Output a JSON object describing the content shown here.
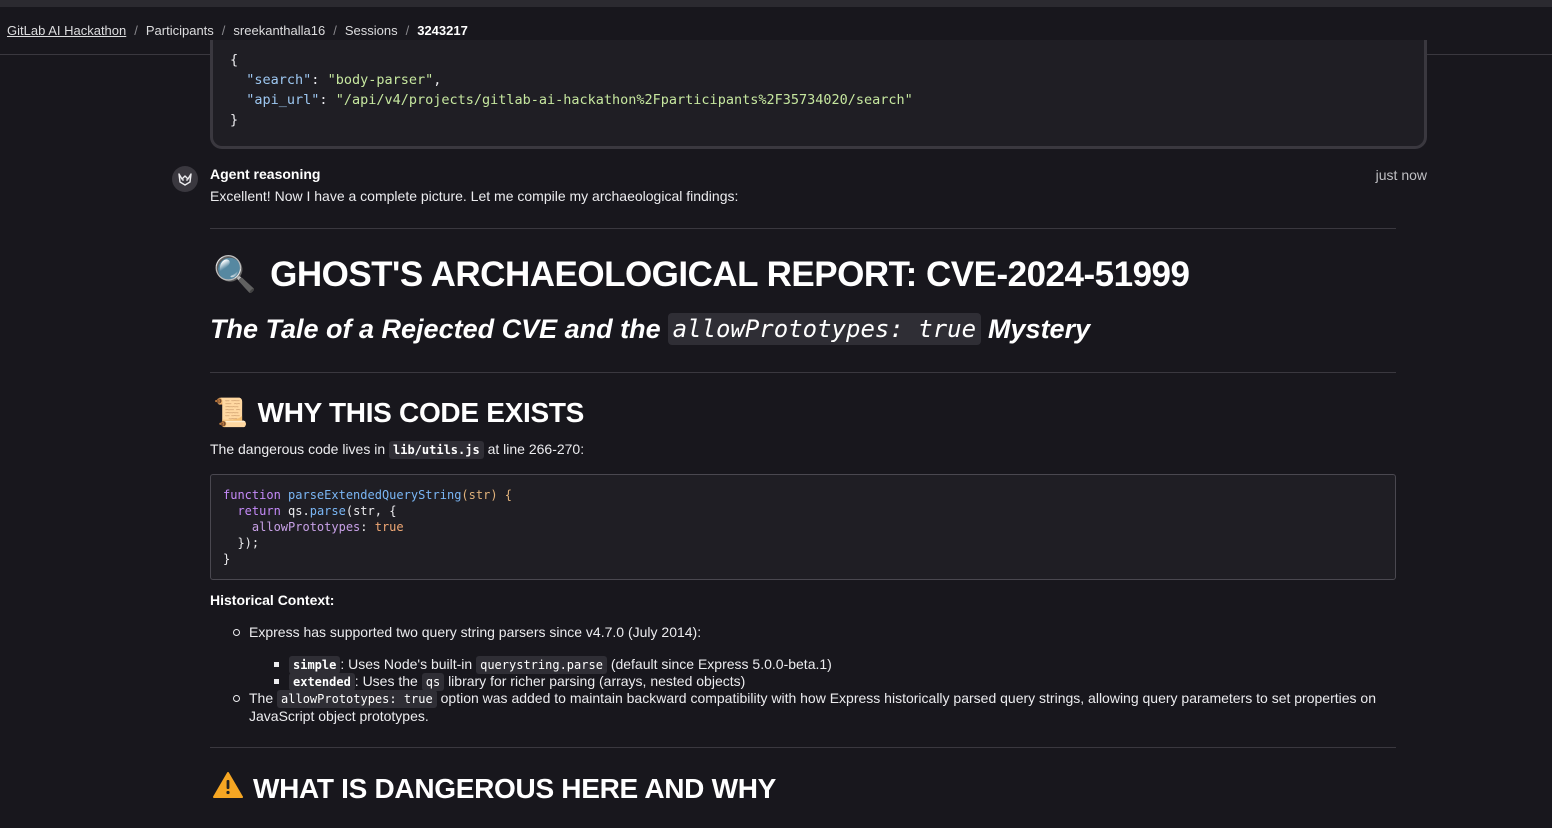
{
  "breadcrumb": {
    "items": [
      "GitLab AI Hackathon",
      "Participants",
      "sreekanthalla16",
      "Sessions",
      "3243217"
    ],
    "separator": "/"
  },
  "json_block": {
    "open": "{",
    "search_key": "\"search\"",
    "search_value": "\"body-parser\"",
    "api_key": "\"api_url\"",
    "api_value": "\"/api/v4/projects/gitlab-ai-hackathon%2Fparticipants%2F35734020/search\"",
    "close": "}"
  },
  "message": {
    "author": "Agent reasoning",
    "timestamp": "just now",
    "text": "Excellent! Now I have a complete picture. Let me compile my archaeological findings:"
  },
  "report": {
    "title_emoji": "🔍",
    "title": "GHOST'S ARCHAEOLOGICAL REPORT: CVE-2024-51999",
    "subtitle_pre": "The Tale of a Rejected CVE and the",
    "subtitle_code": "allowPrototypes: true",
    "subtitle_post": "Mystery",
    "section1_emoji": "📜",
    "section1_title": "WHY THIS CODE EXISTS",
    "section1_intro_pre": "The dangerous code lives in",
    "section1_intro_code": "lib/utils.js",
    "section1_intro_post": "at line 266-270:",
    "code_lines": {
      "l1_kw": "function",
      "l1_fn": "parseExtendedQueryString",
      "l1_arg": "(str) {",
      "l2_kw": "return",
      "l2_obj": "qs.",
      "l2_fn": "parse",
      "l2_rest": "(str, {",
      "l3_prop": "allowPrototypes",
      "l3_val": "true",
      "l4": "});",
      "l5": "}"
    },
    "historical_label": "Historical Context:",
    "bullet1": "Express has supported two query string parsers since v4.7.0 (July 2014):",
    "sub1_code": "simple",
    "sub1_pre": ": Uses Node's built-in",
    "sub1_code2": "querystring.parse",
    "sub1_post": "(default since Express 5.0.0-beta.1)",
    "sub2_code": "extended",
    "sub2_pre": ": Uses the",
    "sub2_code2": "qs",
    "sub2_post": "library for richer parsing (arrays, nested objects)",
    "bullet2_pre": "The",
    "bullet2_code": "allowPrototypes: true",
    "bullet2_post": "option was added to maintain backward compatibility with how Express historically parsed query strings, allowing query parameters to set",
    "bullet2_line2": "properties on JavaScript object prototypes.",
    "section2_emoji": "⚠",
    "section2_title": "WHAT IS DANGEROUS HERE AND WHY"
  },
  "icons": {
    "avatar": "tanuki-icon",
    "magnifier": "magnifier-emoji-icon",
    "scroll": "scroll-emoji-icon",
    "warning": "warning-emoji-icon"
  }
}
